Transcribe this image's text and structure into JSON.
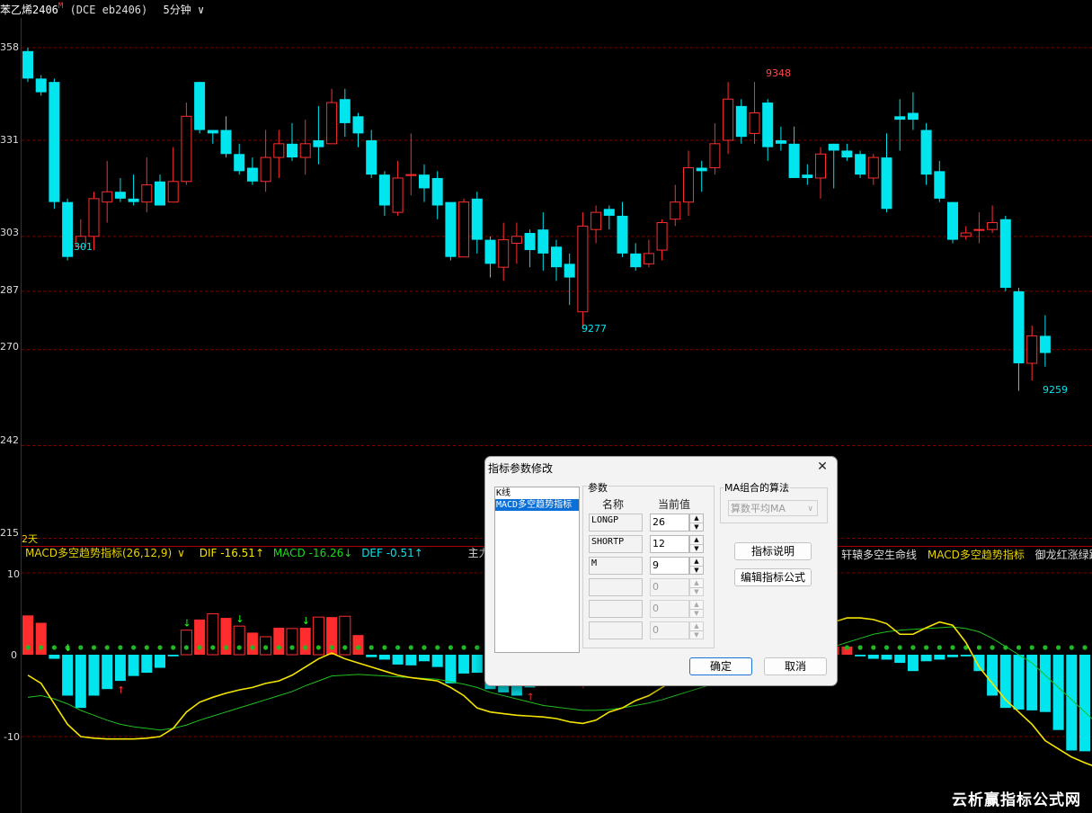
{
  "header": {
    "symbol": "苯乙烯2406",
    "marker": "M",
    "exchange": "(DCE eb2406)",
    "period": "5分钟",
    "period_arrow": "∨"
  },
  "price_axis": {
    "labels": [
      "358",
      "331",
      "303",
      "287",
      "270",
      "242",
      "215"
    ],
    "values": [
      9358,
      9331,
      9303,
      9287,
      9270,
      9242,
      9215
    ]
  },
  "price_markers": {
    "high": "9348",
    "low1": "9301",
    "low2": "9277",
    "low3": "9259"
  },
  "days_label": "2天",
  "macd_bar": {
    "name": "MACD多空趋势指标(26,12,9)",
    "dropdown": "∨",
    "dif": "DIF -16.51↑",
    "macd": "MACD -16.26↓",
    "def": "DEF -0.51↑",
    "tab1": "主力吸筹指标",
    "tab2": "轩辕多空生命线",
    "tab3": "MACD多空趋势指标",
    "tab4": "御龙红涨绿跌指"
  },
  "macd_axis": {
    "labels": [
      "10",
      "0",
      "-10"
    ]
  },
  "colors": {
    "up": "#ff2d2d",
    "down": "#00e5ee",
    "dif_line": "#f5e400",
    "dea_line": "#1fbf1f",
    "grid": "#7a0000"
  },
  "chart_data": {
    "type": "candlestick",
    "ylim": [
      9212,
      9362
    ],
    "candles": [
      [
        9357,
        9349,
        9358,
        9348
      ],
      [
        9349,
        9345,
        9350,
        9344
      ],
      [
        9348,
        9313,
        9349,
        9311
      ],
      [
        9313,
        9297,
        9314,
        9296
      ],
      [
        9300,
        9303,
        9308,
        9300
      ],
      [
        9303,
        9314,
        9316,
        9299
      ],
      [
        9313,
        9316,
        9325,
        9307
      ],
      [
        9316,
        9314,
        9320,
        9313
      ],
      [
        9314,
        9313,
        9321,
        9312
      ],
      [
        9313,
        9318,
        9326,
        9310
      ],
      [
        9319,
        9312,
        9321,
        9312
      ],
      [
        9313,
        9319,
        9329,
        9313
      ],
      [
        9319,
        9338,
        9342,
        9318
      ],
      [
        9348,
        9334,
        9348,
        9333
      ],
      [
        9334,
        9333,
        9334,
        9330
      ],
      [
        9334,
        9327,
        9338,
        9326
      ],
      [
        9327,
        9322,
        9330,
        9321
      ],
      [
        9323,
        9319,
        9326,
        9318
      ],
      [
        9319,
        9326,
        9334,
        9316
      ],
      [
        9326,
        9330,
        9334,
        9320
      ],
      [
        9330,
        9326,
        9336,
        9325
      ],
      [
        9326,
        9330,
        9337,
        9321
      ],
      [
        9331,
        9329,
        9341,
        9324
      ],
      [
        9330,
        9342,
        9346,
        9330
      ],
      [
        9343,
        9336,
        9346,
        9332
      ],
      [
        9338,
        9333,
        9339,
        9329
      ],
      [
        9331,
        9321,
        9334,
        9320
      ],
      [
        9321,
        9312,
        9322,
        9309
      ],
      [
        9310,
        9320,
        9325,
        9309
      ],
      [
        9321,
        9321,
        9333,
        9315
      ],
      [
        9321,
        9317,
        9324,
        9313
      ],
      [
        9320,
        9312,
        9322,
        9308
      ],
      [
        9313,
        9297,
        9313,
        9296
      ],
      [
        9297,
        9313,
        9314,
        9297
      ],
      [
        9314,
        9302,
        9316,
        9298
      ],
      [
        9302,
        9295,
        9303,
        9291
      ],
      [
        9294,
        9302,
        9307,
        9290
      ],
      [
        9301,
        9303,
        9307,
        9295
      ],
      [
        9304,
        9299,
        9305,
        9294
      ],
      [
        9305,
        9298,
        9310,
        9293
      ],
      [
        9300,
        9294,
        9302,
        9290
      ],
      [
        9295,
        9291,
        9298,
        9283
      ],
      [
        9281,
        9306,
        9310,
        9276
      ],
      [
        9305,
        9310,
        9312,
        9301
      ],
      [
        9311,
        9309,
        9312,
        9305
      ],
      [
        9309,
        9298,
        9313,
        9297
      ],
      [
        9298,
        9294,
        9301,
        9293
      ],
      [
        9295,
        9298,
        9302,
        9294
      ],
      [
        9299,
        9307,
        9308,
        9296
      ],
      [
        9308,
        9313,
        9318,
        9306
      ],
      [
        9313,
        9323,
        9328,
        9309
      ],
      [
        9323,
        9322,
        9325,
        9316
      ],
      [
        9323,
        9330,
        9336,
        9321
      ],
      [
        9331,
        9343,
        9348,
        9327
      ],
      [
        9341,
        9332,
        9343,
        9330
      ],
      [
        9333,
        9339,
        9348,
        9330
      ],
      [
        9342,
        9329,
        9343,
        9325
      ],
      [
        9331,
        9330,
        9335,
        9328
      ],
      [
        9330,
        9320,
        9335,
        9320
      ],
      [
        9321,
        9320,
        9324,
        9318
      ],
      [
        9320,
        9327,
        9329,
        9314
      ],
      [
        9330,
        9328,
        9330,
        9317
      ],
      [
        9328,
        9326,
        9330,
        9325
      ],
      [
        9327,
        9321,
        9328,
        9320
      ],
      [
        9320,
        9326,
        9327,
        9318
      ],
      [
        9326,
        9311,
        9333,
        9310
      ],
      [
        9338,
        9337,
        9343,
        9328
      ],
      [
        9339,
        9337,
        9345,
        9334
      ],
      [
        9334,
        9321,
        9336,
        9318
      ],
      [
        9322,
        9314,
        9325,
        9313
      ],
      [
        9313,
        9302,
        9313,
        9301
      ],
      [
        9303,
        9304,
        9306,
        9302
      ],
      [
        9305,
        9305,
        9310,
        9301
      ],
      [
        9305,
        9307,
        9312,
        9304
      ],
      [
        9308,
        9288,
        9309,
        9287
      ],
      [
        9287,
        9266,
        9288,
        9258
      ],
      [
        9266,
        9274,
        9277,
        9261
      ],
      [
        9274,
        9269,
        9280,
        9265
      ]
    ],
    "macd_hist": [
      4.8,
      3.9,
      -0.5,
      -5,
      -6.5,
      -5,
      -4.2,
      -3.2,
      -2.6,
      -2.2,
      -1.6,
      -0.2,
      3,
      4.3,
      5,
      4.5,
      3.5,
      2.7,
      2.2,
      3.3,
      3.2,
      3.3,
      4.6,
      4.6,
      4.7,
      2.4,
      -0.3,
      -0.6,
      -1.2,
      -1.3,
      -0.8,
      -1.5,
      -3.5,
      -2.3,
      -2.2,
      -4.2,
      -4.6,
      -5,
      -4,
      -3.6,
      -3.5,
      -3.2,
      -2.6,
      -2.3,
      -2.1,
      -1.6,
      -1.5,
      -1.4,
      -1.5,
      -1.2,
      -1,
      -0.8,
      -0.6,
      -0.5,
      -0.5,
      -0.4,
      -0.4,
      -0.3,
      -0.3,
      -0.3,
      -0.3,
      1,
      1,
      -0.2,
      -0.5,
      -0.6,
      -1,
      -2,
      -0.8,
      -0.6,
      -0.3,
      -0.2,
      -2,
      -5,
      -6.5,
      -6.7,
      -6.8,
      -7,
      -9.2,
      -11.7,
      -11.8,
      -12
    ],
    "dif": [
      -2.5,
      -3.5,
      -6,
      -8.5,
      -10,
      -10.2,
      -10.3,
      -10.3,
      -10.3,
      -10.2,
      -10,
      -9,
      -7,
      -5.8,
      -5.2,
      -4.7,
      -4.3,
      -4,
      -3.5,
      -3.2,
      -2.5,
      -1.5,
      -0.5,
      0.2,
      -0.5,
      -1,
      -1.5,
      -2,
      -2.5,
      -2.8,
      -3,
      -3.2,
      -4,
      -5,
      -6.5,
      -7,
      -7.2,
      -7.4,
      -7.5,
      -7.6,
      -7.8,
      -8.2,
      -8.4,
      -8,
      -7,
      -6.5,
      -5.6,
      -5,
      -4,
      -3,
      -2,
      -1,
      0,
      0.5,
      1,
      1.5,
      2,
      2.2,
      2.5,
      3,
      3.5,
      4,
      4.5,
      4.5,
      4.3,
      3.8,
      2.5,
      2.5,
      3.3,
      4,
      3.6,
      1.5,
      -1.5,
      -3.5,
      -5.5,
      -7,
      -8.5,
      -10.5,
      -11.5,
      -12.5,
      -13.2,
      -13.8
    ],
    "dea": [
      -5.2,
      -5,
      -5.4,
      -6,
      -6.8,
      -7.4,
      -8,
      -8.5,
      -8.8,
      -9,
      -9.2,
      -9,
      -8.6,
      -8,
      -7.5,
      -7,
      -6.5,
      -6,
      -5.5,
      -5,
      -4.5,
      -3.8,
      -3.2,
      -2.6,
      -2.5,
      -2.4,
      -2.5,
      -2.6,
      -2.7,
      -2.8,
      -2.9,
      -3,
      -3.3,
      -3.6,
      -4,
      -4.6,
      -5,
      -5.4,
      -5.8,
      -6.2,
      -6.4,
      -6.6,
      -6.8,
      -6.8,
      -6.7,
      -6.5,
      -6.2,
      -5.9,
      -5.5,
      -5,
      -4.5,
      -4,
      -3.5,
      -3,
      -2.5,
      -2,
      -1.5,
      -1,
      -0.5,
      0,
      0.5,
      1,
      1.5,
      2,
      2.5,
      2.8,
      3,
      3.1,
      3.2,
      3.3,
      3.4,
      3.2,
      2.8,
      2,
      1,
      0,
      -1,
      -2.5,
      -4,
      -5.5,
      -7,
      -8.5
    ],
    "up_arrows": [
      1,
      7,
      38,
      42,
      59
    ],
    "down_arrows": [
      3,
      12,
      16,
      21
    ]
  },
  "dialog": {
    "title": "指标参数修改",
    "close": "✕",
    "list_items": [
      "K线",
      "MACD多空趋势指标"
    ],
    "params_group": "参数",
    "col_name": "名称",
    "col_value": "当前值",
    "params": [
      {
        "name": "LONGP",
        "value": "26"
      },
      {
        "name": "SHORTP",
        "value": "12"
      },
      {
        "name": "M",
        "value": "9"
      },
      {
        "name": "",
        "value": "0"
      },
      {
        "name": "",
        "value": "0"
      },
      {
        "name": "",
        "value": "0"
      }
    ],
    "ma_group": "MA组合的算法",
    "ma_method": "算数平均MA",
    "btn_explain": "指标说明",
    "btn_edit": "编辑指标公式",
    "btn_ok": "确定",
    "btn_cancel": "取消"
  },
  "watermark": "云析赢指标公式网"
}
